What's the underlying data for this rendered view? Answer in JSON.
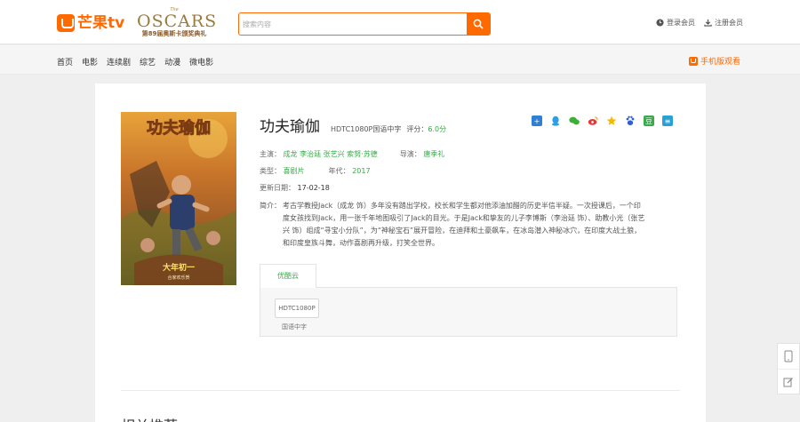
{
  "header": {
    "logo_text": "芒果tv",
    "oscars_the": "The",
    "oscars_title": "OSCARS",
    "oscars_sub": "第89届奥斯卡颁奖典礼",
    "search_placeholder": "搜索内容",
    "login": "登录会员",
    "register": "注册会员"
  },
  "nav": {
    "items": [
      "首页",
      "电影",
      "连续剧",
      "综艺",
      "动漫",
      "微电影"
    ],
    "mobile": "手机版观看"
  },
  "movie": {
    "title": "功夫瑜伽",
    "quality": "HDTC1080P国语中字",
    "score_label": "评分：",
    "score": "6.0分",
    "cast_label": "主演：",
    "cast": "成龙 李治廷 张艺兴 索努·苏德",
    "director_label": "导演：",
    "director": "唐季礼",
    "type_label": "类型：",
    "type": "喜剧片",
    "year_label": "年代：",
    "year": "2017",
    "date_label": "更新日期：",
    "date": "17-02-18",
    "desc_label": "简介：",
    "desc": "考古学教授Jack（成龙 饰）多年没有踏出学校，校长和学生都对他添油加醋的历史半信半疑。一次授课后，一个印度女孩找到Jack，用一张千年地图吸引了Jack的目光。于是Jack和挚友的儿子李博斯（李治廷 饰）、助教小光（张艺兴 饰）组成“寻宝小分队”，为“神秘宝石”展开冒险，在迪拜和土豪飙车，在冰岛潜入神秘冰穴，在印度大战土狼，和印度皇族斗舞，动作喜剧再升级，打笑全世界。",
    "poster_title": "功夫瑜伽",
    "poster_date": "大年初一",
    "poster_note": "合家欢乐贺"
  },
  "sources": {
    "tab": "优酷云",
    "button": "HDTC1080P",
    "lang": "国语中字"
  },
  "related_title": "相关推荐",
  "colors": {
    "accent": "#ff6a00",
    "green": "#3aaa4a"
  }
}
